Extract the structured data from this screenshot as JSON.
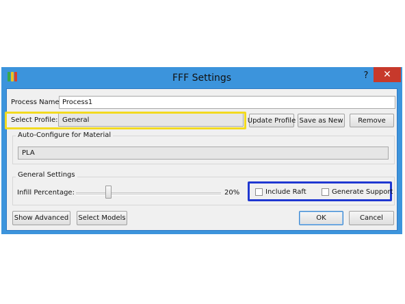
{
  "window": {
    "title": "FFF Settings",
    "help_label": "?",
    "close_label": "✕",
    "icon": "app-logo-icon"
  },
  "process": {
    "name_label": "Process Name:",
    "name_value": "Process1"
  },
  "profile": {
    "label": "Select Profile:",
    "selected": "General",
    "update_button": "Update Profile",
    "save_as_new_button": "Save as New",
    "remove_button": "Remove"
  },
  "material": {
    "group_title": "Auto-Configure for Material",
    "selected": "PLA"
  },
  "general_settings": {
    "group_title": "General Settings",
    "infill_label": "Infill Percentage:",
    "infill_value_text": "20%",
    "infill_percent": 20,
    "include_raft_label": "Include Raft",
    "include_raft_checked": false,
    "generate_support_label": "Generate Support",
    "generate_support_checked": false
  },
  "footer": {
    "show_advanced_button": "Show Advanced",
    "select_models_button": "Select Models",
    "ok_button": "OK",
    "cancel_button": "Cancel"
  },
  "colors": {
    "window_frame": "#3c94dc",
    "close_button": "#c7392b",
    "highlight_yellow": "#f2da1f",
    "highlight_blue": "#1f37d1"
  }
}
